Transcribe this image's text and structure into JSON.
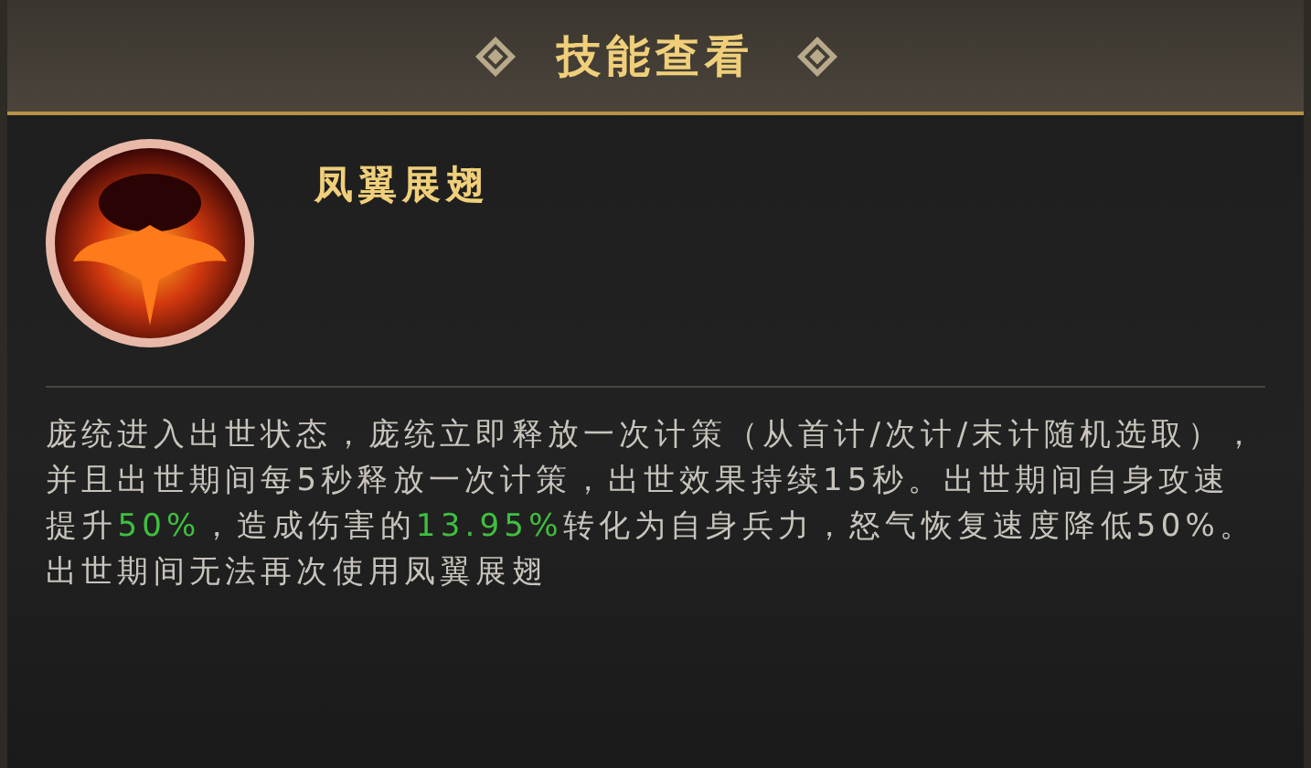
{
  "window": {
    "title": "技能查看"
  },
  "skill": {
    "name": "凤翼展翅",
    "description": [
      {
        "text": "庞统进入出世状态，庞统立即释放一次计策（从首计/次计/末计随机选取），并且出世期间每5秒释放一次计策，出世效果持续15秒。出世期间自身攻速提升",
        "highlight": false
      },
      {
        "text": "50%",
        "highlight": true
      },
      {
        "text": "，造成伤害的",
        "highlight": false
      },
      {
        "text": "13.95%",
        "highlight": true
      },
      {
        "text": "转化为自身兵力，怒气恢复速度降低50%。出世期间无法再次使用凤翼展翅",
        "highlight": false
      }
    ]
  }
}
